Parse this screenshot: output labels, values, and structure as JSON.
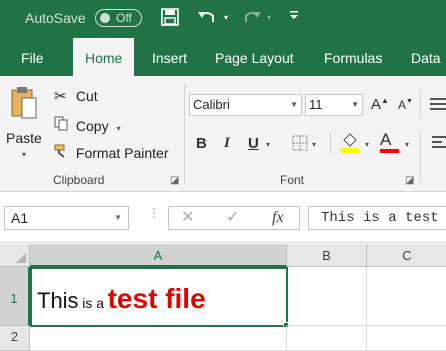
{
  "titlebar": {
    "autosave_label": "AutoSave",
    "autosave_state": "Off",
    "save_icon": "save-icon",
    "undo_icon": "undo-icon",
    "redo_icon": "redo-icon",
    "customize_icon": "customize-qat-icon"
  },
  "tabs": [
    "File",
    "Home",
    "Insert",
    "Page Layout",
    "Formulas",
    "Data"
  ],
  "active_tab": "Home",
  "clipboard": {
    "paste_label": "Paste",
    "cut_label": "Cut",
    "copy_label": "Copy",
    "format_painter_label": "Format Painter",
    "group_label": "Clipboard"
  },
  "font": {
    "family": "Calibri",
    "size": "11",
    "bold": "B",
    "italic": "I",
    "underline": "U",
    "grow": "A",
    "shrink": "A",
    "font_color": "A",
    "group_label": "Font",
    "highlight_color": "#ffff00",
    "font_color_value": "#ff0000"
  },
  "formula_bar": {
    "name_box": "A1",
    "cancel": "✕",
    "enter": "✓",
    "fx": "fx",
    "content": "This is a test"
  },
  "grid": {
    "columns": [
      "A",
      "B",
      "C"
    ],
    "rows": [
      "1",
      "2"
    ],
    "cell_a1": {
      "part1": "This",
      "part2": "is a",
      "part3": "test file",
      "accent": "#ff0000"
    }
  },
  "colors": {
    "brand": "#217346",
    "ribbon_bg": "#f3f3f3"
  }
}
